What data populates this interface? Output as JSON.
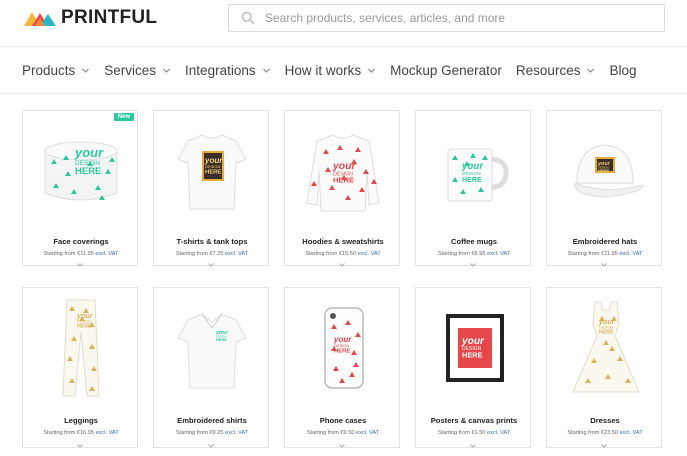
{
  "brand": {
    "name": "PRINTFUL"
  },
  "search": {
    "placeholder": "Search products, services, articles, and more"
  },
  "nav": [
    {
      "label": "Products",
      "has_dropdown": true
    },
    {
      "label": "Services",
      "has_dropdown": true
    },
    {
      "label": "Integrations",
      "has_dropdown": true
    },
    {
      "label": "How it works",
      "has_dropdown": true
    },
    {
      "label": "Mockup Generator",
      "has_dropdown": false
    },
    {
      "label": "Resources",
      "has_dropdown": true
    },
    {
      "label": "Blog",
      "has_dropdown": false
    }
  ],
  "products": [
    {
      "title": "Face coverings",
      "price": "Starting from €11.95",
      "vat": "excl. VAT",
      "badge": "New",
      "icon": "face-covering-icon"
    },
    {
      "title": "T-shirts & tank tops",
      "price": "Starting from €7.25",
      "vat": "excl. VAT",
      "icon": "tshirt-icon"
    },
    {
      "title": "Hoodies & sweatshirts",
      "price": "Starting from €15.50",
      "vat": "excl. VAT",
      "icon": "sweatshirt-icon"
    },
    {
      "title": "Coffee mugs",
      "price": "Starting from €6.95",
      "vat": "excl. VAT",
      "icon": "mug-icon"
    },
    {
      "title": "Embroidered hats",
      "price": "Starting from €11.95",
      "vat": "excl. VAT",
      "icon": "hat-icon"
    },
    {
      "title": "Leggings",
      "price": "Starting from €16.95",
      "vat": "excl. VAT",
      "icon": "leggings-icon"
    },
    {
      "title": "Embroidered shirts",
      "price": "Starting from €9.25",
      "vat": "excl. VAT",
      "icon": "polo-shirt-icon"
    },
    {
      "title": "Phone cases",
      "price": "Starting from €9.50",
      "vat": "excl. VAT",
      "icon": "phone-case-icon"
    },
    {
      "title": "Posters & canvas prints",
      "price": "Starting from €1.50",
      "vat": "excl. VAT",
      "icon": "poster-icon"
    },
    {
      "title": "Dresses",
      "price": "Starting from €23.50",
      "vat": "excl. VAT",
      "icon": "dress-icon"
    }
  ],
  "colors": {
    "teal": "#2cc9a0",
    "red": "#e6474a",
    "gold": "#d9b35a",
    "accent_link": "#3a6fb0"
  },
  "design_text": {
    "line1": "your",
    "line2": "DESIGN",
    "line3": "HERE"
  }
}
